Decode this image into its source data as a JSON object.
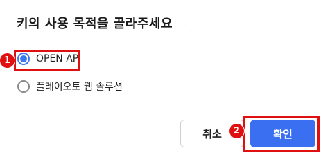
{
  "dialog": {
    "title": "키의 사용 목적을 골라주세요",
    "title_trailing_dot": ".",
    "options": [
      {
        "label": "OPEN API",
        "checked": true
      },
      {
        "label": "플레이오토 웹 솔루션",
        "checked": false
      }
    ],
    "buttons": {
      "cancel_label": "취소",
      "confirm_label": "확인"
    }
  },
  "annotations": {
    "step1": "1",
    "step2": "2"
  },
  "colors": {
    "accent": "#3a78f2",
    "confirm_button": "#3a6ff2",
    "highlight": "#e01010"
  }
}
